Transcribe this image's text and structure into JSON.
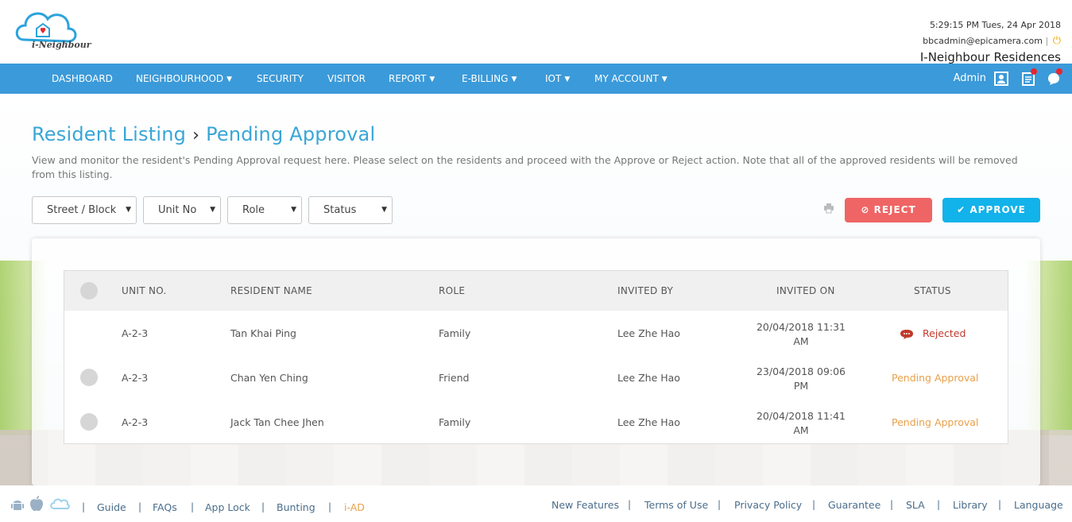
{
  "header": {
    "logo_text": "i-Neighbour",
    "datetime": "5:29:15 PM  Tues, 24 Apr 2018",
    "email": "bbcadmin@epicamera.com",
    "site_name": "I-Neighbour Residences"
  },
  "nav": {
    "items": [
      {
        "label": "DASHBOARD",
        "dropdown": false
      },
      {
        "label": "NEIGHBOURHOOD",
        "dropdown": true
      },
      {
        "label": "SECURITY",
        "dropdown": false
      },
      {
        "label": "VISITOR",
        "dropdown": false
      },
      {
        "label": "REPORT",
        "dropdown": true
      },
      {
        "label": "E-BILLING",
        "dropdown": true
      },
      {
        "label": "IOT",
        "dropdown": true
      },
      {
        "label": "MY ACCOUNT",
        "dropdown": true
      }
    ],
    "user": "Admin",
    "icons": [
      "profile-icon",
      "notes-icon",
      "chat-bell-icon"
    ]
  },
  "page": {
    "breadcrumb_parent": "Resident Listing",
    "breadcrumb_separator": "›",
    "breadcrumb_current": "Pending Approval",
    "description": "View and monitor the resident's Pending Approval request here. Please select on the residents and proceed with the Approve or Reject action. Note that all of the approved residents will be removed from this listing."
  },
  "filters": {
    "street": "Street / Block",
    "unit": "Unit No",
    "role": "Role",
    "status": "Status"
  },
  "actions": {
    "reject_icon": "⊘",
    "reject": "REJECT",
    "approve_icon": "✔",
    "approve": "APPROVE"
  },
  "table": {
    "headers": {
      "unit": "UNIT NO.",
      "name": "RESIDENT NAME",
      "role": "ROLE",
      "invited_by": "INVITED BY",
      "invited_on": "INVITED ON",
      "status": "STATUS"
    },
    "rows": [
      {
        "unit": "A-2-3",
        "name": "Tan Khai Ping",
        "role": "Family",
        "invited_by": "Lee Zhe Hao",
        "invited_on_1": "20/04/2018 11:31",
        "invited_on_2": "AM",
        "status": "Rejected",
        "selectable": false
      },
      {
        "unit": "A-2-3",
        "name": "Chan Yen Ching",
        "role": "Friend",
        "invited_by": "Lee Zhe Hao",
        "invited_on_1": "23/04/2018 09:06",
        "invited_on_2": "PM",
        "status": "Pending Approval",
        "selectable": true
      },
      {
        "unit": "A-2-3",
        "name": "Jack Tan Chee Jhen",
        "role": "Family",
        "invited_by": "Lee Zhe Hao",
        "invited_on_1": "20/04/2018 11:41",
        "invited_on_2": "AM",
        "status": "Pending Approval",
        "selectable": true
      }
    ]
  },
  "colors": {
    "nav_bg": "#3b9ad9",
    "title": "#39a6d6",
    "reject": "#ef6565",
    "approve": "#12b2ea",
    "rejected_text": "#c0392b",
    "pending_text": "#e8a04b"
  },
  "footer": {
    "left_links": [
      "Guide",
      "FAQs",
      "App Lock",
      "Bunting",
      "i-AD"
    ],
    "right_links": [
      "New Features",
      "Terms of Use",
      "Privacy Policy",
      "Guarantee",
      "SLA",
      "Library",
      "Language"
    ],
    "separator": "|",
    "icons": [
      "android-icon",
      "apple-icon",
      "ineighbour-cloud-icon"
    ]
  }
}
